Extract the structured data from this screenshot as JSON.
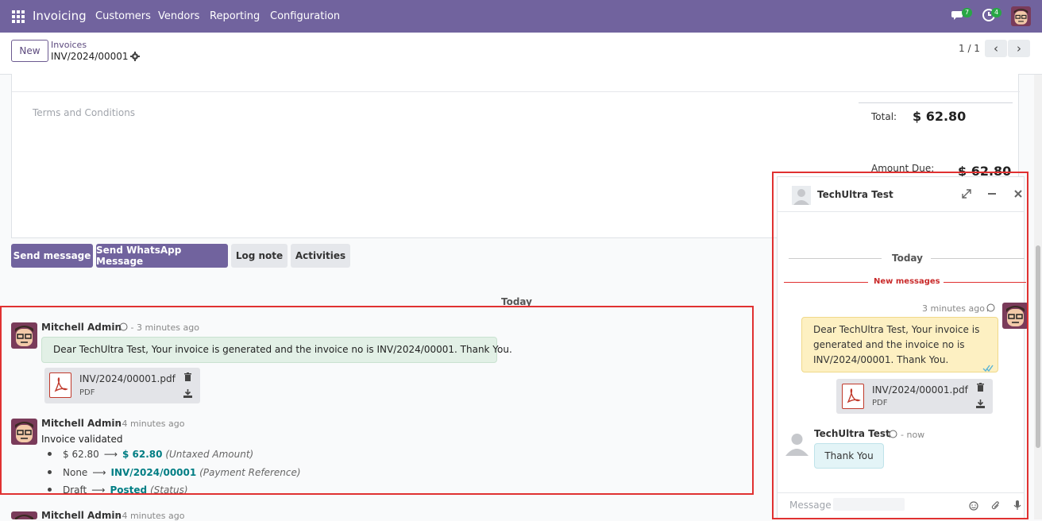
{
  "topbar": {
    "app_name": "Invoicing",
    "menu": [
      "Customers",
      "Vendors",
      "Reporting",
      "Configuration"
    ],
    "messages_badge": "7",
    "activities_badge": "4"
  },
  "control_panel": {
    "new_label": "New",
    "breadcrumb_parent": "Invoices",
    "breadcrumb_current": "INV/2024/00001",
    "pager": "1 / 1"
  },
  "sheet": {
    "terms_placeholder": "Terms and Conditions",
    "total_label": "Total:",
    "total_value": "$ 62.80",
    "amount_due_label": "Amount Due:",
    "amount_due_value": "$ 62.80"
  },
  "chatter": {
    "buttons": [
      "Send message",
      "Send WhatsApp Message",
      "Log note",
      "Activities"
    ],
    "date_separator": "Today",
    "messages": [
      {
        "author": "Mitchell Admin",
        "meta": "- 3 minutes ago",
        "body": "Dear TechUltra Test, Your invoice is generated and the invoice no is INV/2024/00001. Thank You.",
        "attachment_name": "INV/2024/00001.pdf",
        "attachment_type": "PDF"
      },
      {
        "author": "Mitchell Admin",
        "meta": "- 4 minutes ago",
        "body": "Invoice validated",
        "tracking": [
          {
            "old": "$ 62.80",
            "new": "$ 62.80",
            "field": "(Untaxed Amount)"
          },
          {
            "old": "None",
            "new": "INV/2024/00001",
            "field": "(Payment Reference)"
          },
          {
            "old": "Draft",
            "new": "Posted",
            "field": "(Status)"
          }
        ]
      },
      {
        "author": "Mitchell Admin",
        "meta": "- 4 minutes ago"
      }
    ]
  },
  "chat_window": {
    "title": "TechUltra Test",
    "date_separator": "Today",
    "new_messages": "New messages",
    "out_message": {
      "time": "3 minutes ago",
      "body": "Dear TechUltra Test, Your invoice is generated and the invoice no is INV/2024/00001. Thank You.",
      "attachment_name": "INV/2024/00001.pdf",
      "attachment_type": "PDF"
    },
    "in_message": {
      "author": "TechUltra Test",
      "time": "- now",
      "body": "Thank You"
    },
    "composer_placeholder": "Message 9196"
  },
  "colors": {
    "brand": "#71639e",
    "accent_link": "#017e84",
    "highlight_box": "#e03131"
  }
}
